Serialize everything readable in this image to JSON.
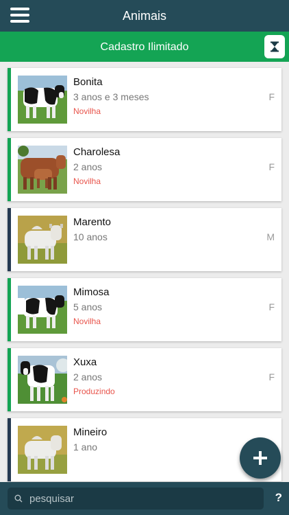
{
  "header": {
    "title": "Animais",
    "menu_icon": "hamburger-menu-icon"
  },
  "banner": {
    "text": "Cadastro Ilimitado",
    "icon": "hourglass-icon"
  },
  "animals": [
    {
      "name": "Bonita",
      "age": "3 anos e 3 meses",
      "status": "Novilha",
      "sex": "F",
      "photo": "holstein-cow"
    },
    {
      "name": "Charolesa",
      "age": "2 anos",
      "status": "Novilha",
      "sex": "F",
      "photo": "brown-cow-with-calf"
    },
    {
      "name": "Marento",
      "age": "10 anos",
      "status": "",
      "sex": "M",
      "photo": "white-zebu-bull"
    },
    {
      "name": "Mimosa",
      "age": "5 anos",
      "status": "Novilha",
      "sex": "F",
      "photo": "holstein-cow"
    },
    {
      "name": "Xuxa",
      "age": "2 anos",
      "status": "Produzindo",
      "sex": "F",
      "photo": "holstein-cow"
    },
    {
      "name": "Mineiro",
      "age": "1 ano",
      "status": "",
      "sex": "M",
      "photo": "white-zebu-bull"
    }
  ],
  "fab": {
    "icon": "plus-icon"
  },
  "search": {
    "placeholder": "pesquisar",
    "icon": "search-icon"
  },
  "help": {
    "label": "?"
  },
  "colors": {
    "header": "#254b58",
    "banner": "#14a454",
    "female_stripe": "#14a454",
    "male_stripe": "#253a52",
    "status": "#e8534a"
  }
}
